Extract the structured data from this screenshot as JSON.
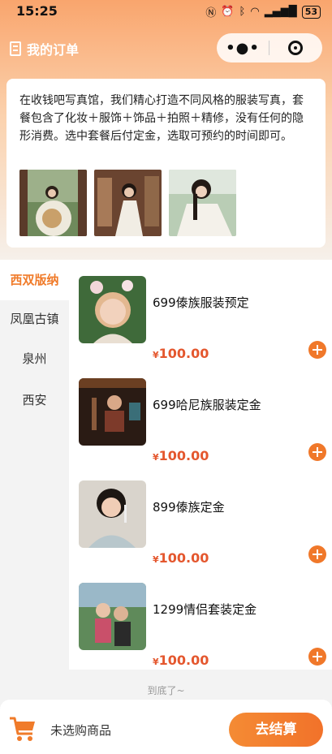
{
  "status_bar": {
    "time": "15:25",
    "icons": [
      "nfc-icon",
      "alarm-icon",
      "bluetooth-icon",
      "wifi-icon",
      "signal-icon"
    ],
    "battery": "53"
  },
  "navbar": {
    "title": "我的订单",
    "more_icon": "•●•",
    "capsule_icons": [
      "more-dots-icon",
      "target-icon"
    ]
  },
  "intro": {
    "text": "在收钱吧写真馆，我们精心打造不同风格的服装写真，套餐包含了化妆＋服饰＋饰品＋拍照＋精修，没有任何的隐形消费。选中套餐后付定金，选取可预约的时间即可。",
    "images": [
      "photo-1",
      "photo-2",
      "photo-3"
    ]
  },
  "categories": [
    {
      "label": "西双版纳",
      "active": true
    },
    {
      "label": "凤凰古镇",
      "active": false
    },
    {
      "label": "泉州",
      "active": false
    },
    {
      "label": "西安",
      "active": false
    }
  ],
  "products": [
    {
      "title": "699傣族服装预定",
      "currency": "¥",
      "price": "100.00"
    },
    {
      "title": "699哈尼族服装定金",
      "currency": "¥",
      "price": "100.00"
    },
    {
      "title": "899傣族定金",
      "currency": "¥",
      "price": "100.00"
    },
    {
      "title": "1299情侣套装定金",
      "currency": "¥",
      "price": "100.00"
    }
  ],
  "end_text": "到底了~",
  "footer": {
    "cart_text": "未选购商品",
    "checkout_label": "去结算"
  },
  "colors": {
    "accent": "#f07b2a",
    "price": "#e4572e",
    "header_top": "#f9a56d"
  }
}
